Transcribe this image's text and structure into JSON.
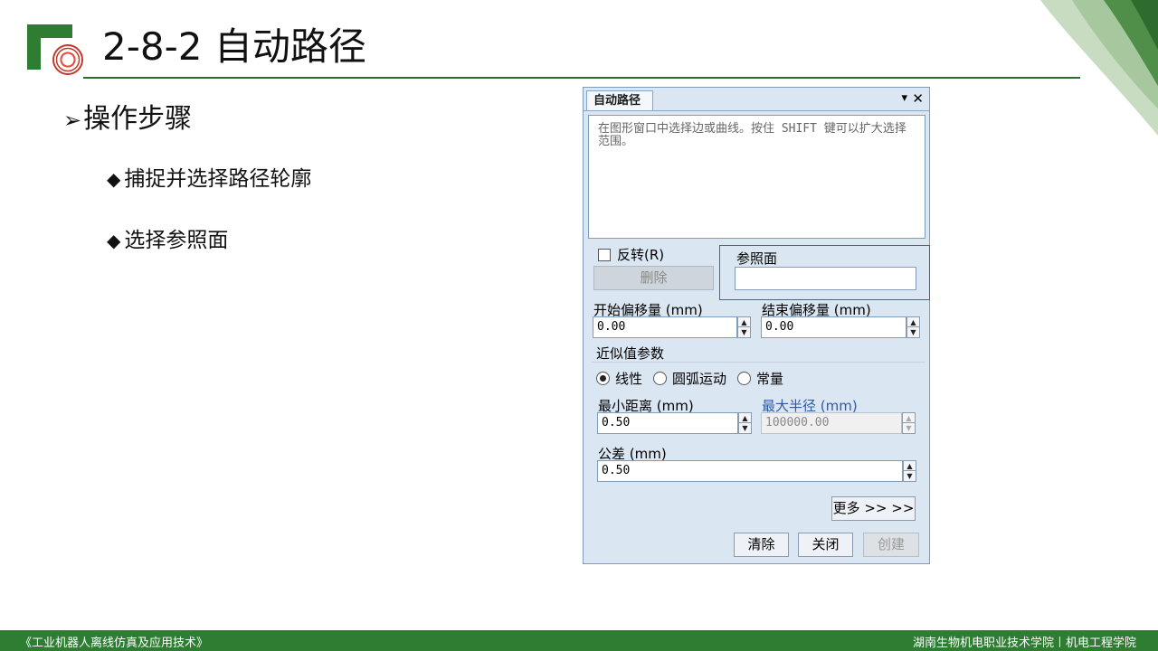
{
  "slide": {
    "title": "2-8-2 自动路径",
    "section_heading": "操作步骤",
    "bullets": [
      "捕捉并选择路径轮廓",
      "选择参照面"
    ],
    "footer_left": "《工业机器人离线仿真及应用技术》",
    "footer_right": "湖南生物机电职业技术学院丨机电工程学院"
  },
  "dialog": {
    "tab_label": "自动路径",
    "pin_icon": "▾",
    "close_icon": "✕",
    "instructions": "在图形窗口中选择边或曲线。按住 SHIFT 键可以扩大选择范围。",
    "reverse_label": "反转(R)",
    "reverse_checked": false,
    "delete_label": "删除",
    "reference_label": "参照面",
    "reference_value": "",
    "start_offset_label": "开始偏移量 (mm)",
    "start_offset_value": "0.00",
    "end_offset_label": "结束偏移量 (mm)",
    "end_offset_value": "0.00",
    "approx_label": "近似值参数",
    "radio_options": [
      "线性",
      "圆弧运动",
      "常量"
    ],
    "radio_selected": "线性",
    "min_distance_label": "最小距离 (mm)",
    "min_distance_value": "0.50",
    "max_radius_label": "最大半径 (mm)",
    "max_radius_value": "100000.00",
    "tolerance_label": "公差 (mm)",
    "tolerance_value": "0.50",
    "more_label": "更多 >> >>",
    "clear_label": "清除",
    "close_label": "关闭",
    "create_label": "创建"
  },
  "colors": {
    "brand_green": "#2e7d32",
    "highlight_red": "#d0312d",
    "dialog_bg": "#dbe6f3"
  }
}
